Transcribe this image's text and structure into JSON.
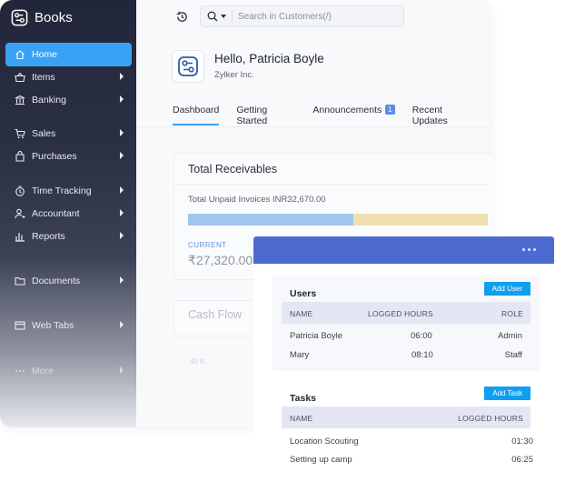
{
  "app": {
    "brand": "Books"
  },
  "sidebar": {
    "items": [
      {
        "label": "Home",
        "icon": "home-icon"
      },
      {
        "label": "Items",
        "icon": "basket-icon"
      },
      {
        "label": "Banking",
        "icon": "bank-icon"
      },
      {
        "label": "Sales",
        "icon": "cart-icon"
      },
      {
        "label": "Purchases",
        "icon": "bag-icon"
      },
      {
        "label": "Time Tracking",
        "icon": "timer-icon"
      },
      {
        "label": "Accountant",
        "icon": "accountant-icon"
      },
      {
        "label": "Reports",
        "icon": "reports-icon"
      },
      {
        "label": "Documents",
        "icon": "folder-icon"
      },
      {
        "label": "Web Tabs",
        "icon": "web-tabs-icon"
      },
      {
        "label": "More",
        "icon": "more-icon"
      }
    ]
  },
  "search": {
    "placeholder": "Search in Customers(/)"
  },
  "header": {
    "greeting": "Hello, Patricia Boyle",
    "org": "Zylker Inc."
  },
  "tabs": [
    {
      "label": "Dashboard"
    },
    {
      "label": "Getting Started"
    },
    {
      "label": "Announcements",
      "badge": "1"
    },
    {
      "label": "Recent Updates"
    }
  ],
  "receivables": {
    "title": "Total Receivables",
    "unpaid": "Total Unpaid Invoices INR32,670.00",
    "current_fraction": 0.55,
    "current_label": "CURRENT",
    "current_value": "₹27,320.00"
  },
  "cashflow": {
    "title": "Cash Flow",
    "tick": "40 K"
  },
  "users": {
    "title": "Users",
    "add_label": "Add User",
    "columns": [
      "NAME",
      "LOGGED HOURS",
      "ROLE"
    ],
    "rows": [
      {
        "name": "Patricia Boyle",
        "hours": "06:00",
        "role": "Admin"
      },
      {
        "name": "Mary",
        "hours": "08:10",
        "role": "Staff"
      }
    ]
  },
  "tasks": {
    "title": "Tasks",
    "add_label": "Add Task",
    "columns": [
      "NAME",
      "LOGGED HOURS"
    ],
    "rows": [
      {
        "name": "Location Scouting",
        "hours": "01:30"
      },
      {
        "name": "Setting up camp",
        "hours": "06:25"
      }
    ]
  },
  "colors": {
    "accent": "#3aa2f5",
    "panel_header": "#4d6ad0",
    "button": "#0e9ff0",
    "bar_current": "#9fc7f0",
    "bar_overdue": "#f1dfb0"
  }
}
